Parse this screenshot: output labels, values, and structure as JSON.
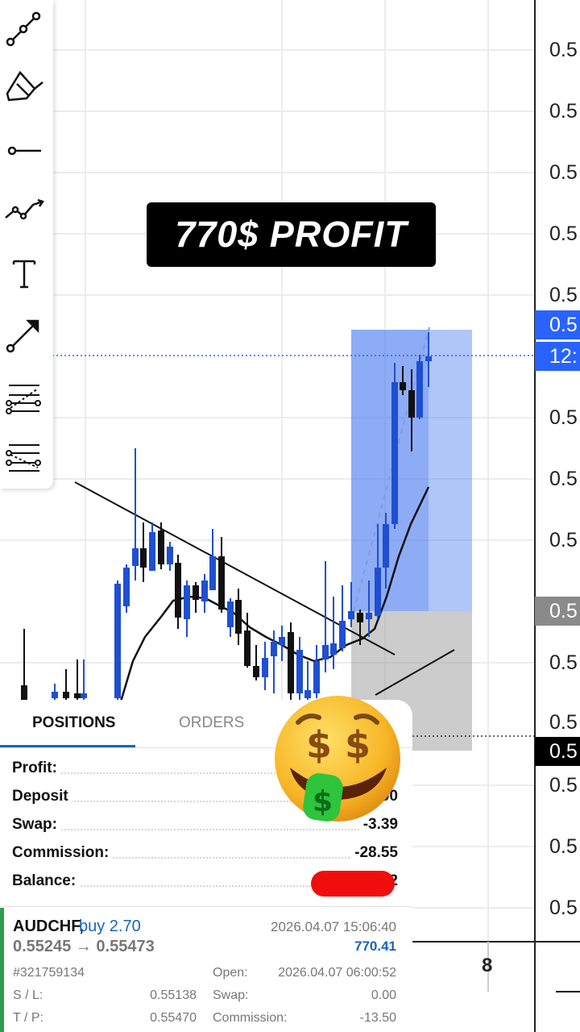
{
  "banner": {
    "text": "770$ PROFIT"
  },
  "price_axis": {
    "tick_labels": [
      "0.5",
      "0.5",
      "0.5",
      "0.5",
      "0.5",
      "0.5",
      "0.5",
      "0.5",
      "0.5",
      "0.5",
      "0.5",
      "0.5",
      "0.5"
    ],
    "current_price_tag": "0.5",
    "countdown_tag": "12:",
    "sl_price_tag": "0.5",
    "gray_tag": "0.5"
  },
  "time_axis": {
    "label": "8"
  },
  "toolbar": {
    "tools": [
      "trend-line-icon",
      "brush-icon",
      "horizontal-ray-icon",
      "path-icon",
      "text-icon",
      "arrow-icon",
      "fib-retracement-icon",
      "fib-fan-icon"
    ]
  },
  "colors": {
    "bull": "#1f4fd1",
    "bear": "#111111",
    "profit_zone": "#4f7ff0",
    "loss_zone": "#9a9a9a",
    "accent": "#1565c0",
    "price_tag_blue": "#2962ff"
  },
  "tabs": {
    "positions": "POSITIONS",
    "orders": "ORDERS"
  },
  "summary": {
    "profit_label": "Profit:",
    "deposit_label": "Deposit",
    "deposit_value": "00",
    "swap_label": "Swap:",
    "swap_value": "-3.39",
    "commission_label": "Commission:",
    "commission_value": "-28.55",
    "balance_label": "Balance:",
    "balance_value": "2"
  },
  "position": {
    "symbol": "AUDCHF,",
    "side": "buy 2.70",
    "prices": "0.55245 → 0.55473",
    "close_time": "2026.04.07 15:06:40",
    "profit": "770.41",
    "ticket": "#321759134",
    "open_label": "Open:",
    "open_time": "2026.04.07 06:00:52",
    "sl_label": "S / L:",
    "sl_value": "0.55138",
    "swap_label": "Swap:",
    "swap_value": "0.00",
    "tp_label": "T / P:",
    "tp_value": "0.55470",
    "commission_label": "Commission:",
    "commission_value": "-13.50"
  }
}
